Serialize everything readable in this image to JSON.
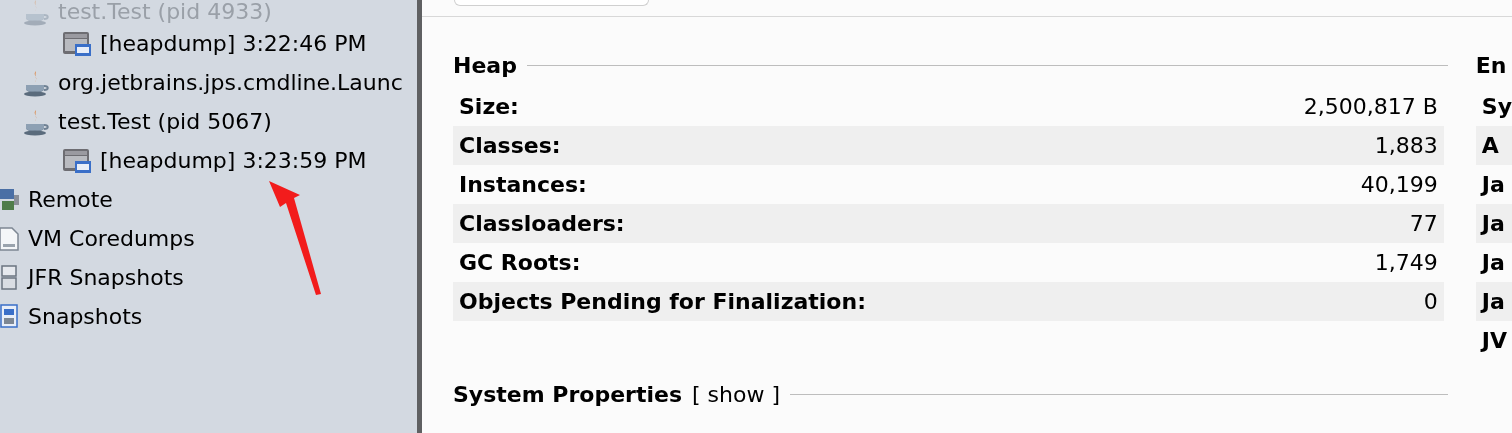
{
  "local_applications": [
    {
      "label": "test.Test (pid 4933)",
      "kind": "app",
      "disabled": true,
      "children": [
        {
          "label": "[heapdump] 3:22:46 PM",
          "kind": "heapdump",
          "disabled": false
        }
      ]
    },
    {
      "label": "org.jetbrains.jps.cmdline.Launc",
      "kind": "app",
      "disabled": false
    },
    {
      "label": "test.Test (pid 5067)",
      "kind": "app",
      "disabled": false,
      "children": [
        {
          "label": "[heapdump] 3:23:59 PM",
          "kind": "heapdump",
          "disabled": false
        }
      ]
    }
  ],
  "nodes": [
    {
      "label": "Remote",
      "kind": "remote"
    },
    {
      "label": "VM Coredumps",
      "kind": "coredump"
    },
    {
      "label": "JFR Snapshots",
      "kind": "jfr"
    },
    {
      "label": "Snapshots",
      "kind": "snapshots"
    }
  ],
  "heap": {
    "title": "Heap",
    "rows": [
      {
        "label": "Size:",
        "value": "2,500,817 B"
      },
      {
        "label": "Classes:",
        "value": "1,883"
      },
      {
        "label": "Instances:",
        "value": "40,199"
      },
      {
        "label": "Classloaders:",
        "value": "77"
      },
      {
        "label": "GC Roots:",
        "value": "1,749"
      },
      {
        "label": "Objects Pending for Finalization:",
        "value": "0"
      }
    ]
  },
  "environment": {
    "title": "En",
    "rows": [
      "Sy",
      "A",
      "Ja",
      "Ja",
      "Ja",
      "Ja",
      "JV"
    ]
  },
  "system_properties": {
    "title": "System Properties",
    "link": "[ show ]"
  }
}
